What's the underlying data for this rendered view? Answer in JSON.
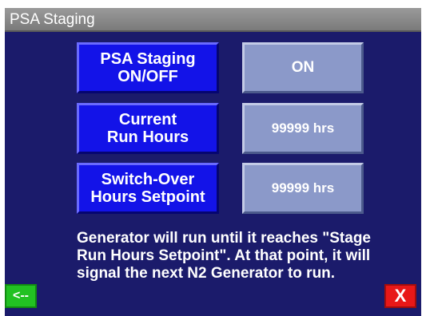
{
  "title": "PSA Staging",
  "rows": [
    {
      "label": "PSA Staging\nON/OFF",
      "value": "ON"
    },
    {
      "label": "Current\nRun Hours",
      "value": "99999 hrs"
    },
    {
      "label": "Switch-Over\nHours Setpoint",
      "value": "99999 hrs"
    }
  ],
  "message": "Generator will run until it reaches \"Stage Run Hours Setpoint\". At that point, it will signal the next N2 Generator to run.",
  "nav": {
    "back_label": "<--",
    "close_label": "X"
  },
  "colors": {
    "background": "#1b1b6b",
    "label_button": "#1313e8",
    "value_button": "#8b99c9",
    "back": "#22c122",
    "close": "#e81818"
  }
}
